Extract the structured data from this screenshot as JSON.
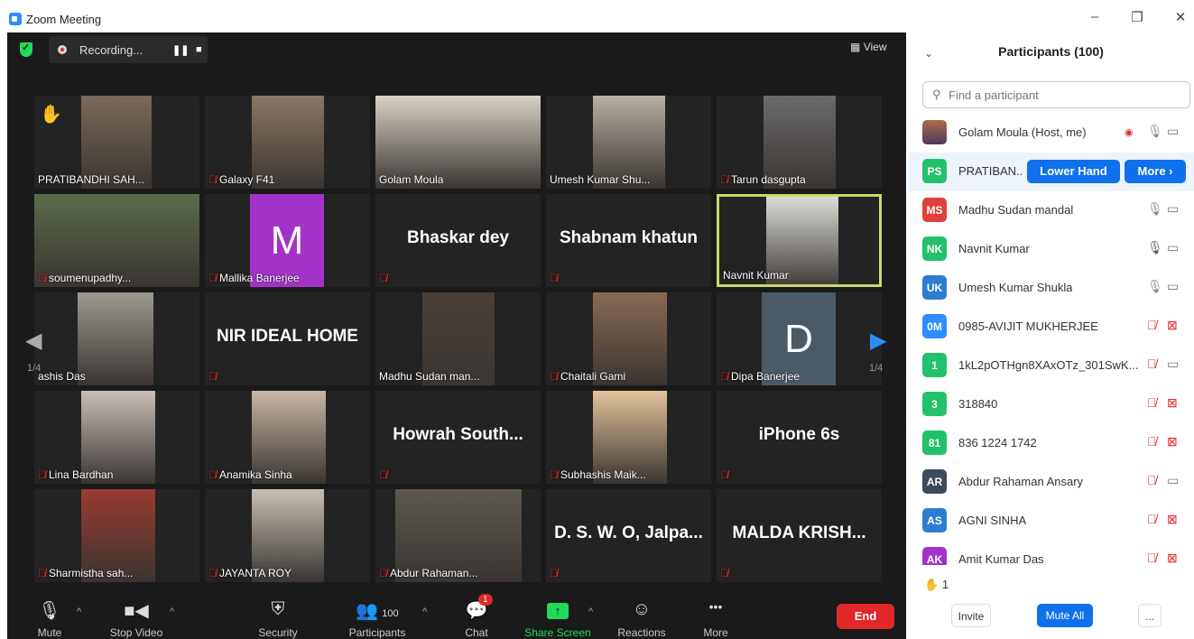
{
  "window": {
    "title": "Zoom Meeting",
    "min": "–",
    "restore": "❐",
    "close": "✕"
  },
  "topbar": {
    "recording_label": "Recording...",
    "pause_glyph": "❚❚",
    "stop_glyph": "■",
    "view_label": "View",
    "view_glyph": "▦"
  },
  "tiles": [
    {
      "name": "PRATIBANDHI SAH...",
      "muted": false,
      "raised_hand": true
    },
    {
      "name": "Galaxy F41",
      "muted": true
    },
    {
      "name": "Golam Moula",
      "muted": false
    },
    {
      "name": "Umesh Kumar Shu...",
      "muted": false
    },
    {
      "name": "Tarun dasgupta",
      "muted": true
    },
    {
      "name": "soumenupadhy...",
      "muted": true
    },
    {
      "name": "Mallika Banerjee",
      "muted": true,
      "letter": "M",
      "letter_color": "#A333C8"
    },
    {
      "name": "",
      "muted": true,
      "display_name": "Bhaskar dey"
    },
    {
      "name": "",
      "muted": true,
      "display_name": "Shabnam khatun"
    },
    {
      "name": "Navnit Kumar",
      "muted": false,
      "active_speaker": true
    },
    {
      "name": "ashis Das",
      "muted": false
    },
    {
      "name": "",
      "muted": true,
      "display_name": "NIR IDEAL HOME"
    },
    {
      "name": "Madhu Sudan man...",
      "muted": false
    },
    {
      "name": "Chaitali Gami",
      "muted": true
    },
    {
      "name": "Dipa Banerjee",
      "muted": true,
      "letter": "D",
      "letter_color": "#4C5A66"
    },
    {
      "name": "Lina Bardhan",
      "muted": true
    },
    {
      "name": "Anamika Sinha",
      "muted": true
    },
    {
      "name": "",
      "muted": true,
      "display_name": "Howrah  South..."
    },
    {
      "name": "Subhashis Maik...",
      "muted": true
    },
    {
      "name": "",
      "muted": true,
      "display_name": "iPhone 6s"
    },
    {
      "name": "Sharmistha sah...",
      "muted": true
    },
    {
      "name": "JAYANTA ROY",
      "muted": true
    },
    {
      "name": "Abdur Rahaman...",
      "muted": true
    },
    {
      "name": "",
      "muted": true,
      "display_name": "D. S. W. O, Jalpa..."
    },
    {
      "name": "",
      "muted": true,
      "display_name": "MALDA  KRISH..."
    }
  ],
  "pager": {
    "left": "1/4",
    "right": "1/4"
  },
  "toolbar": {
    "mute": "Mute",
    "stop_video": "Stop Video",
    "security": "Security",
    "participants": "Participants",
    "participants_count": "100",
    "chat": "Chat",
    "chat_badge": "1",
    "share": "Share Screen",
    "reactions": "Reactions",
    "more": "More",
    "more_glyph": "•••",
    "end": "End"
  },
  "panel": {
    "title": "Participants (100)",
    "search_placeholder": "Find a participant",
    "participants": [
      {
        "initials": "",
        "name": "Golam Moula (Host, me)",
        "color": "#8a5a44",
        "mic": "on",
        "video": "on",
        "recording": true
      },
      {
        "initials": "PS",
        "name": "PRATIBAN...",
        "color": "#23C16B",
        "highlight": true,
        "lower_hand": "Lower Hand",
        "more": "More ›"
      },
      {
        "initials": "MS",
        "name": "Madhu Sudan mandal",
        "color": "#E0403C",
        "mic": "on",
        "video": "on"
      },
      {
        "initials": "NK",
        "name": "Navnit Kumar",
        "color": "#23C16B",
        "mic": "active",
        "video": "on"
      },
      {
        "initials": "UK",
        "name": "Umesh Kumar Shukla",
        "color": "#2D7DD2",
        "mic": "on",
        "video": "on"
      },
      {
        "initials": "0M",
        "name": "0985-AVIJIT MUKHERJEE",
        "color": "#2D8CFF",
        "mic": "off",
        "video": "off"
      },
      {
        "initials": "1",
        "name": "1kL2pOTHgn8XAxOTz_301SwK...",
        "color": "#23C16B",
        "mic": "off",
        "video": "on"
      },
      {
        "initials": "3",
        "name": "318840",
        "color": "#23C16B",
        "mic": "off",
        "video": "off"
      },
      {
        "initials": "81",
        "name": "836 1224 1742",
        "color": "#23C16B",
        "mic": "off",
        "video": "off"
      },
      {
        "initials": "AR",
        "name": "Abdur Rahaman Ansary",
        "color": "#3D4A5C",
        "mic": "off",
        "video": "on"
      },
      {
        "initials": "AS",
        "name": "AGNI SINHA",
        "color": "#2D7DD2",
        "mic": "off",
        "video": "off"
      },
      {
        "initials": "AK",
        "name": "Amit Kumar Das",
        "color": "#A333C8",
        "mic": "off",
        "video": "off"
      }
    ],
    "raised_hands_count": "1",
    "invite": "Invite",
    "mute_all": "Mute All",
    "more": "..."
  }
}
